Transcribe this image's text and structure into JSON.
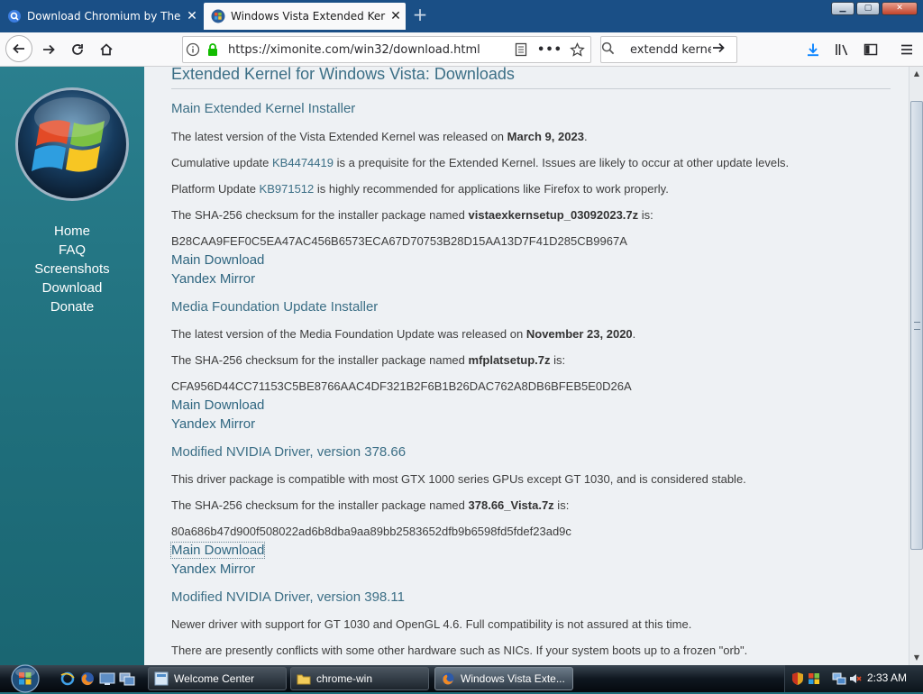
{
  "browser": {
    "tabs": [
      {
        "title": "Download Chromium by The Chromium Authors",
        "active": false
      },
      {
        "title": "Windows Vista Extended Kernel",
        "active": true
      }
    ],
    "new_tab_label": "+",
    "url": "https://ximonite.com/win32/download.html",
    "search_value": "extendd kernel"
  },
  "sidebar": {
    "nav": [
      "Home",
      "FAQ",
      "Screenshots",
      "Download",
      "Donate"
    ]
  },
  "page": {
    "title": "Extended Kernel for Windows Vista: Downloads",
    "sections": [
      {
        "heading": "Main Extended Kernel Installer",
        "release_prefix": "The latest version of the Vista Extended Kernel was released on ",
        "release_date": "March 9, 2023",
        "cumulative_prefix": "Cumulative update ",
        "cumulative_link": "KB4474419",
        "cumulative_suffix": " is a prequisite for the Extended Kernel. Issues are likely to occur at other update levels.",
        "platform_prefix": "Platform Update ",
        "platform_link": "KB971512",
        "platform_suffix": " is highly recommended for applications like Firefox to work properly.",
        "checksum_prefix": "The SHA-256 checksum for the installer package named ",
        "package": "vistaexkernsetup_03092023.7z",
        "checksum_suffix": " is:",
        "checksum": "B28CAA9FEF0C5EA47AC456B6573ECA67D70753B28D15AA13D7F41D285CB9967A",
        "main_download": "Main Download",
        "mirror": "Yandex Mirror"
      },
      {
        "heading": "Media Foundation Update Installer",
        "release_prefix": "The latest version of the Media Foundation Update was released on ",
        "release_date": "November 23, 2020",
        "checksum_prefix": "The SHA-256 checksum for the installer package named ",
        "package": "mfplatsetup.7z",
        "checksum_suffix": " is:",
        "checksum": "CFA956D44CC71153C5BE8766AAC4DF321B2F6B1B26DAC762A8DB6BFEB5E0D26A",
        "main_download": "Main Download",
        "mirror": "Yandex Mirror"
      },
      {
        "heading": "Modified NVIDIA Driver, version 378.66",
        "description": "This driver package is compatible with most GTX 1000 series GPUs except GT 1030, and is considered stable.",
        "checksum_prefix": "The SHA-256 checksum for the installer package named ",
        "package": "378.66_Vista.7z",
        "checksum_suffix": " is:",
        "checksum": "80a686b47d900f508022ad6b8dba9aa89bb2583652dfb9b6598fd5fdef23ad9c",
        "main_download": "Main Download",
        "mirror": "Yandex Mirror"
      },
      {
        "heading": "Modified NVIDIA Driver, version 398.11",
        "description": "Newer driver with support for GT 1030 and OpenGL 4.6. Full compatibility is not assured at this time.",
        "note": "There are presently conflicts with some other hardware such as NICs. If your system boots up to a frozen \"orb\"."
      }
    ]
  },
  "taskbar": {
    "buttons": [
      {
        "label": "Welcome Center",
        "active": false
      },
      {
        "label": "chrome-win",
        "active": false
      },
      {
        "label": "Windows Vista Exte...",
        "active": true
      }
    ],
    "clock": "2:33 AM"
  },
  "colors": {
    "sidebar": "#2a7f8e",
    "heading": "#3c6f86",
    "tabstrip": "#1a4f86"
  }
}
